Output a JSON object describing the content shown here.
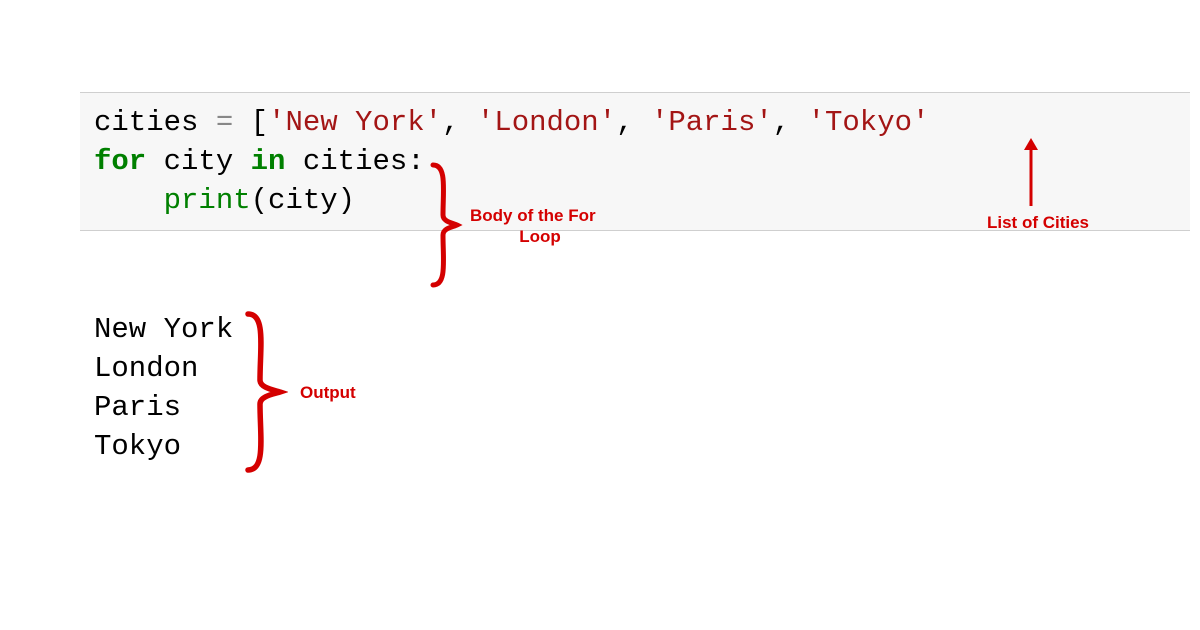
{
  "code": {
    "var_name": "cities",
    "assign": " = ",
    "lb": "[",
    "str1": "'New York'",
    "c1": ", ",
    "str2": "'London'",
    "c2": ", ",
    "str3": "'Paris'",
    "c3": ", ",
    "str4": "'Tokyo'",
    "blank": "",
    "for_kw": "for",
    "sp1": " ",
    "loop_var": "city",
    "sp2": " ",
    "in_kw": "in",
    "sp3": " ",
    "iter": "cities",
    "colon": ":",
    "indent": "    ",
    "print_fn": "print",
    "lp": "(",
    "arg": "city",
    "rp": ")"
  },
  "output": {
    "l1": "New York",
    "l2": "London",
    "l3": "Paris",
    "l4": "Tokyo"
  },
  "annotations": {
    "body": "Body of the For Loop",
    "body_l1": "Body of the For",
    "body_l2": "Loop",
    "list": "List of Cities",
    "output": "Output"
  }
}
